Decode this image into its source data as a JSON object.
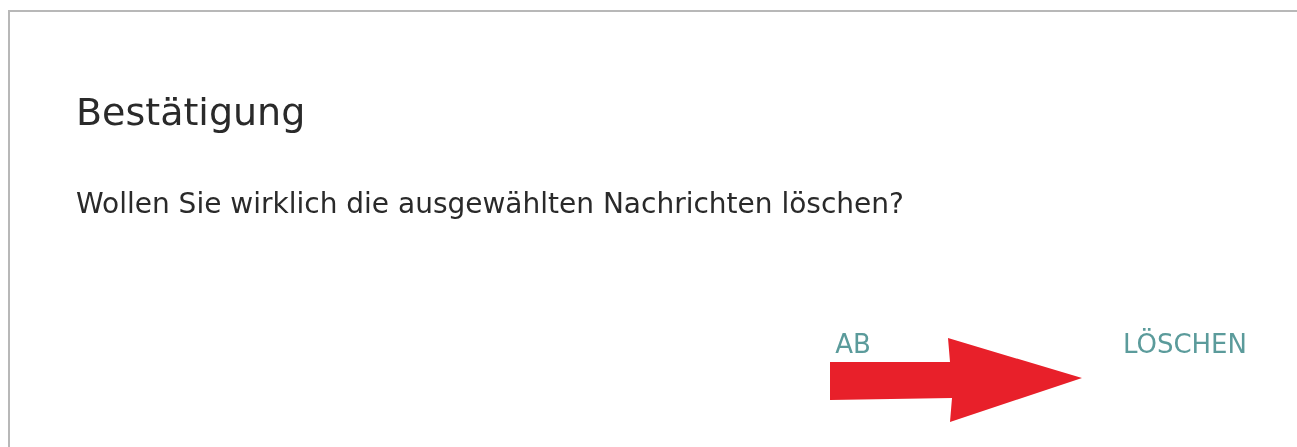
{
  "dialog": {
    "title": "Bestätigung",
    "message": "Wollen Sie wirklich die ausgewählten Nachrichten löschen?",
    "buttons": [
      "AB",
      "LÖSCHEN"
    ]
  }
}
